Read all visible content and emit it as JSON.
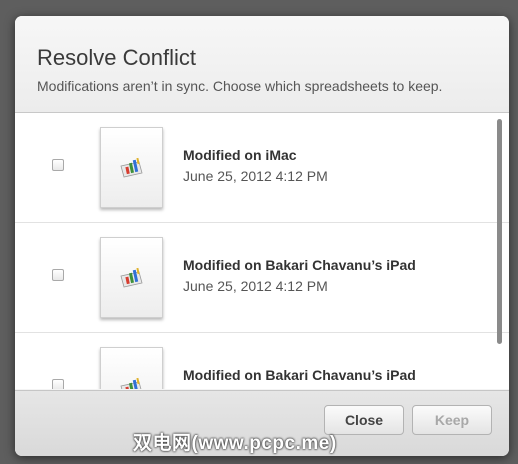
{
  "dialog": {
    "title": "Resolve Conflict",
    "subtitle": "Modifications aren’t in sync. Choose which spreadsheets to keep."
  },
  "versions": [
    {
      "title": "Modified on iMac",
      "date": "June 25, 2012 4:12 PM",
      "checked": false,
      "icon": "numbers-spreadsheet-icon"
    },
    {
      "title": "Modified on Bakari Chavanu’s iPad",
      "date": "June 25, 2012 4:12 PM",
      "checked": false,
      "icon": "numbers-spreadsheet-icon"
    },
    {
      "title": "Modified on Bakari Chavanu’s iPad",
      "date": "",
      "checked": false,
      "icon": "numbers-spreadsheet-icon"
    }
  ],
  "buttons": {
    "close_label": "Close",
    "keep_label": "Keep",
    "keep_enabled": false
  },
  "watermark": "双电网(www.pcpc.me)",
  "colors": {
    "backdrop": "#5e5e5e",
    "dialog": "#f4f4f4",
    "disabled_text": "#a8a8a8"
  }
}
